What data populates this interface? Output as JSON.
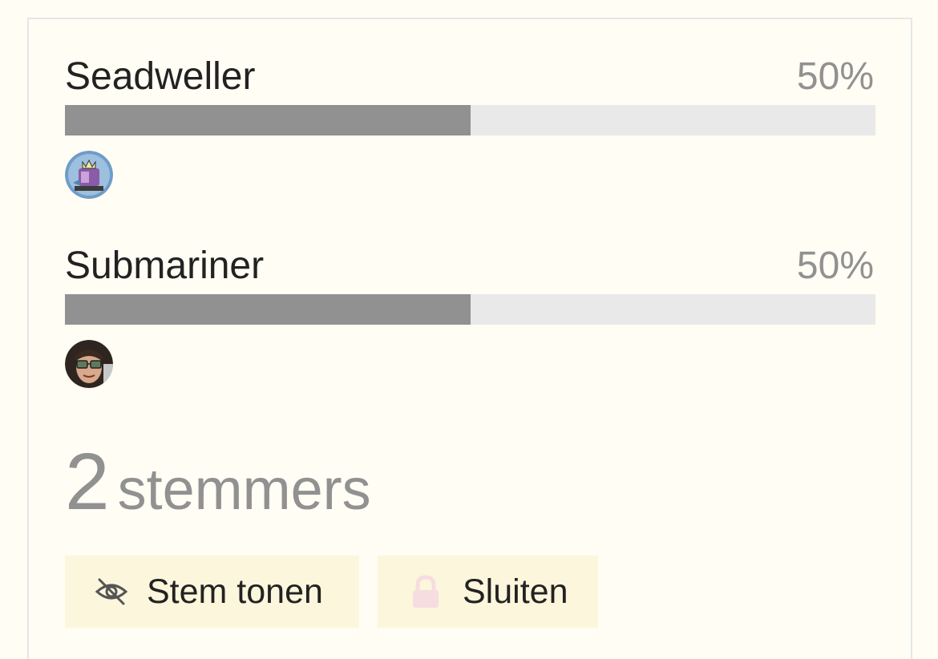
{
  "poll": {
    "options": [
      {
        "name": "Seadweller",
        "percent_label": "50%",
        "percent": 50
      },
      {
        "name": "Submariner",
        "percent_label": "50%",
        "percent": 50
      }
    ],
    "voters": {
      "count": "2",
      "label": "stemmers"
    },
    "buttons": {
      "show_votes_label": "Stem tonen",
      "show_votes_icon": "eye-slash-icon",
      "close_label": "Sluiten",
      "close_icon": "lock-icon"
    }
  },
  "colors": {
    "background": "#fffdf4",
    "bar_fill": "#919191",
    "bar_track": "#e9e9e9",
    "button_bg": "#fcf6dc",
    "lock_icon": "#f6dde0"
  }
}
